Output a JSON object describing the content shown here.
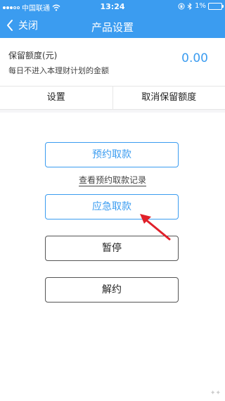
{
  "status_bar": {
    "carrier": "中国联通",
    "time": "13:24",
    "battery": "1%"
  },
  "nav": {
    "back_label": "关闭",
    "title": "产品设置"
  },
  "info": {
    "label": "保留额度(元)",
    "description": "每日不进入本理财计划的金额",
    "amount": "0.00"
  },
  "actions": {
    "set_label": "设置",
    "cancel_label": "取消保留额度"
  },
  "main": {
    "scheduled_withdraw": "预约取款",
    "view_records": "查看预约取款记录",
    "emergency_withdraw": "应急取款",
    "pause": "暂停",
    "terminate": "解约"
  },
  "colors": {
    "accent": "#3b9cf0",
    "annotation_arrow": "#e0202a"
  }
}
